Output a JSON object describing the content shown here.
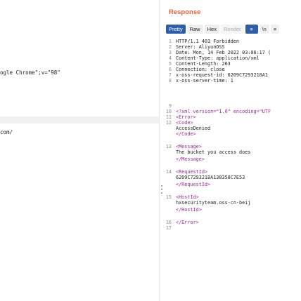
{
  "left_pane": {
    "lines": [
      "ogle Chrome\";v=\"98\"",
      "com/"
    ]
  },
  "response": {
    "title": "Response",
    "tabs": [
      "Pretty",
      "Raw",
      "Hex",
      "Render"
    ],
    "active_tab": "Pretty",
    "newline_label": "\\n",
    "menu_label": "≡"
  },
  "code": {
    "lines": [
      {
        "n": "1",
        "t": "HTTP/1.1 403 Forbidden"
      },
      {
        "n": "2",
        "t": "Server: AliyunOSS"
      },
      {
        "n": "3",
        "t": "Date: Mon, 14 Feb 2022 03:06:17 ("
      },
      {
        "n": "4",
        "t": "Content-Type: application/xml"
      },
      {
        "n": "5",
        "t": "Content-Length: 263"
      },
      {
        "n": "6",
        "t": "Connection: close"
      },
      {
        "n": "7",
        "t": "x-oss-request-id: 6209C7293218A1"
      },
      {
        "n": "8",
        "t": "x-oss-server-time: 1"
      },
      {
        "n": "9",
        "t": ""
      },
      {
        "n": "10",
        "t": "<?xml version=\"1.0\" encoding=\"UTF"
      },
      {
        "n": "11",
        "t": "  <Error>"
      },
      {
        "n": "12",
        "t": "    <Code>"
      },
      {
        "n": "",
        "t": "      AccessDenied"
      },
      {
        "n": "",
        "t": "    </Code>"
      },
      {
        "n": "13",
        "t": "    <Message>"
      },
      {
        "n": "",
        "t": "      The bucket you access does"
      },
      {
        "n": "",
        "t": "    </Message>"
      },
      {
        "n": "14",
        "t": "    <RequestId>"
      },
      {
        "n": "",
        "t": "      6209C7293218A138358C7E53"
      },
      {
        "n": "",
        "t": "    </RequestId>"
      },
      {
        "n": "15",
        "t": "    <HostId>"
      },
      {
        "n": "",
        "t": "      hxsecurityteam.oss-cn-beij"
      },
      {
        "n": "",
        "t": "    </HostId>"
      },
      {
        "n": "16",
        "t": "  </Error>"
      },
      {
        "n": "17",
        "t": ""
      }
    ]
  }
}
